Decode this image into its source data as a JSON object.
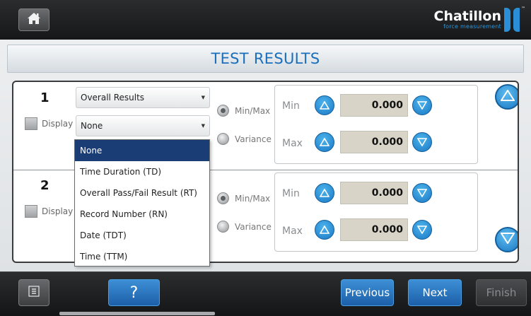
{
  "header": {
    "brand_name": "Chatillon",
    "brand_tagline": "force measurement",
    "brand_tm": "™"
  },
  "page_title": "TEST RESULTS",
  "rows": [
    {
      "number": "1",
      "display_label": "Display",
      "result_select": "Overall Results",
      "field_select": "None",
      "mode_minmax": "Min/Max",
      "mode_variance": "Variance",
      "min_label": "Min",
      "max_label": "Max",
      "min_value": "0.000",
      "max_value": "0.000"
    },
    {
      "number": "2",
      "display_label": "Display",
      "mode_minmax": "Min/Max",
      "mode_variance": "Variance",
      "min_label": "Min",
      "max_label": "Max",
      "min_value": "0.000",
      "max_value": "0.000"
    }
  ],
  "dropdown": {
    "options": [
      "None",
      "Time Duration (TD)",
      "Overall Pass/Fail Result (RT)",
      "Record Number (RN)",
      "Date (TDT)",
      "Time (TTM)"
    ],
    "selected": "None"
  },
  "footer": {
    "help_label": "?",
    "previous_label": "Previous",
    "next_label": "Next",
    "finish_label": "Finish"
  },
  "colors": {
    "accent": "#1a78c4",
    "title": "#1a6fbb",
    "dropdown_selected": "#1a3d76"
  }
}
